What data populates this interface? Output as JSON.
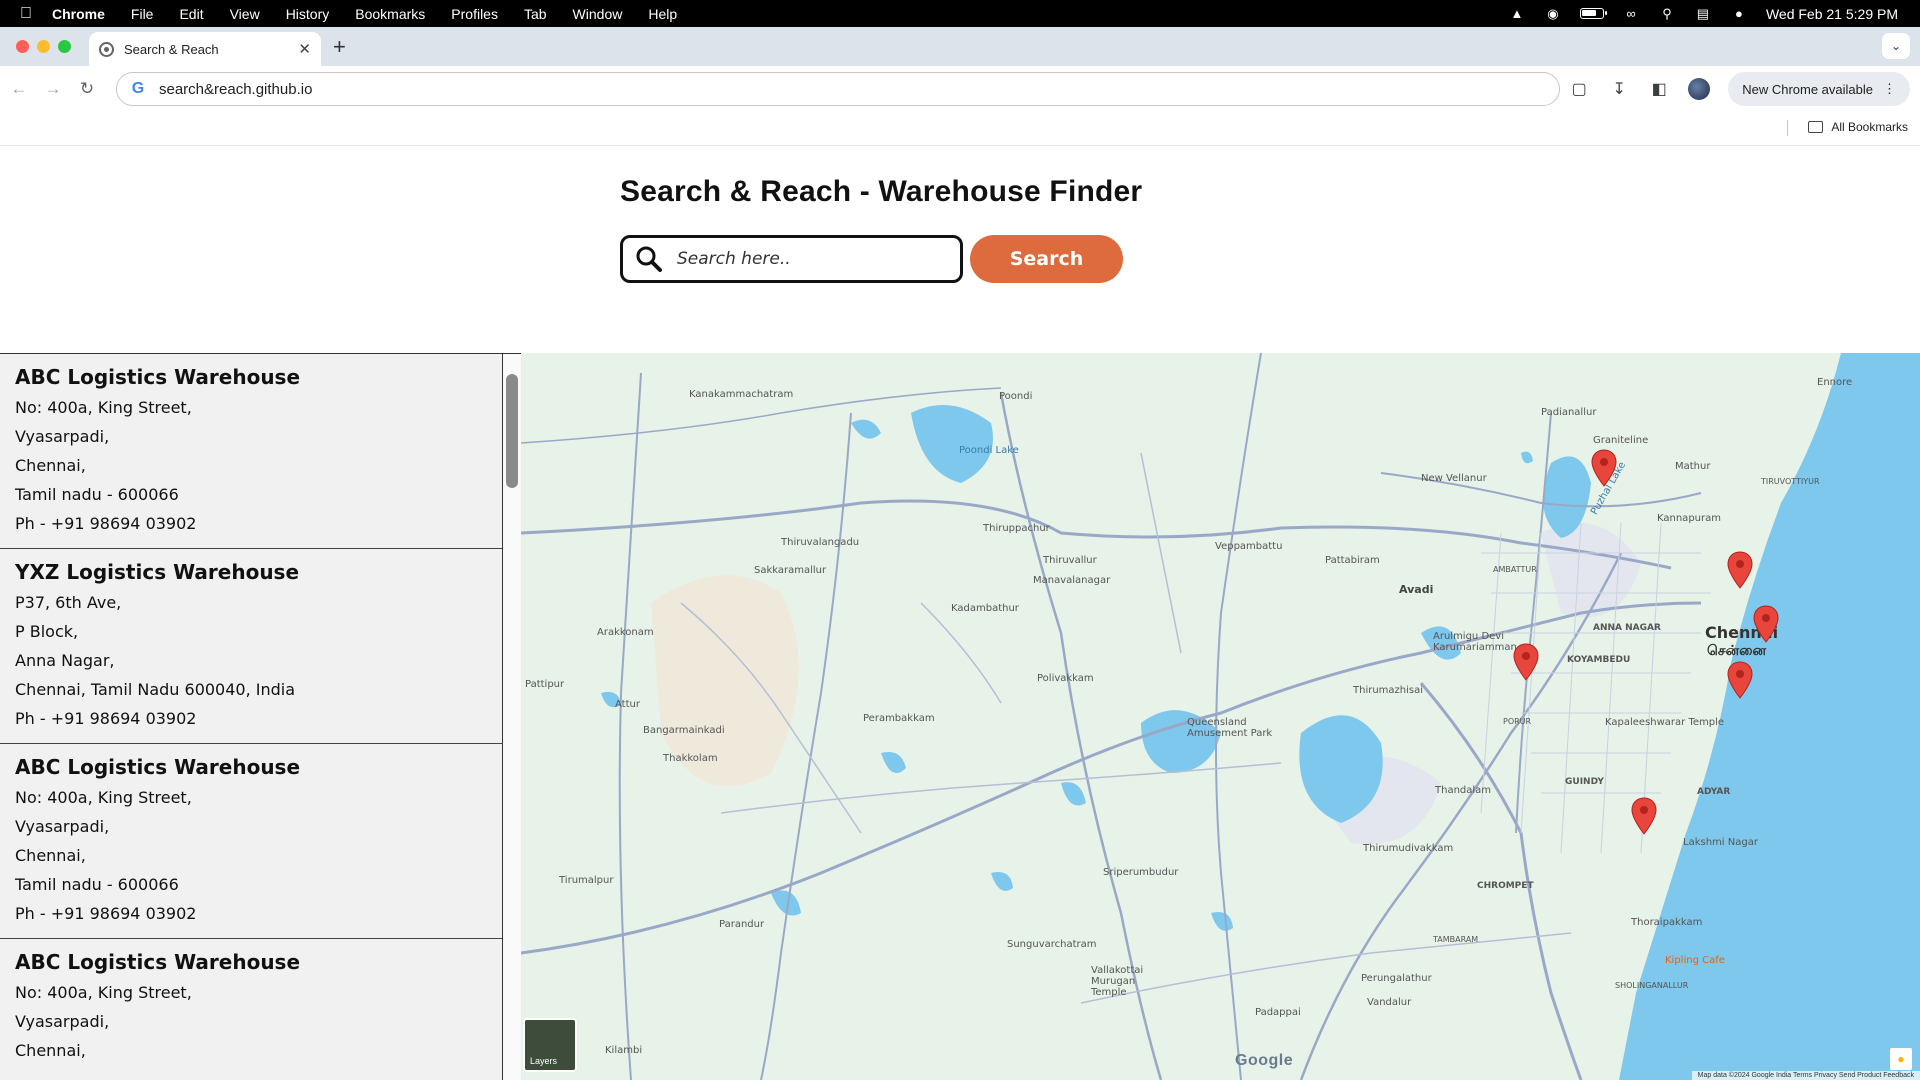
{
  "menubar": {
    "app_name": "Chrome",
    "items": [
      "File",
      "Edit",
      "View",
      "History",
      "Bookmarks",
      "Profiles",
      "Tab",
      "Window",
      "Help"
    ],
    "datetime": "Wed Feb 21  5:29 PM"
  },
  "browser": {
    "tab_title": "Search & Reach",
    "url": "search&reach.github.io",
    "new_chrome_label": "New Chrome available",
    "all_bookmarks_label": "All Bookmarks"
  },
  "page": {
    "title": "Search & Reach - Warehouse Finder",
    "search_placeholder": "Search here..",
    "search_button": "Search"
  },
  "warehouses": [
    {
      "name": "ABC Logistics Warehouse",
      "address_lines": [
        "No: 400a, King Street,",
        "Vyasarpadi,",
        "Chennai,",
        "Tamil nadu - 600066"
      ],
      "phone": "Ph - +91 98694 03902"
    },
    {
      "name": "YXZ Logistics Warehouse",
      "address_lines": [
        "P37, 6th Ave,",
        "P Block,",
        "Anna Nagar,",
        "Chennai, Tamil Nadu 600040, India"
      ],
      "phone": "Ph - +91 98694 03902"
    },
    {
      "name": "ABC Logistics Warehouse",
      "address_lines": [
        "No: 400a, King Street,",
        "Vyasarpadi,",
        "Chennai,",
        "Tamil nadu - 600066"
      ],
      "phone": "Ph - +91 98694 03902"
    },
    {
      "name": "ABC Logistics Warehouse",
      "address_lines": [
        "No: 400a, King Street,",
        "Vyasarpadi,",
        "Chennai,"
      ],
      "phone": ""
    }
  ],
  "map": {
    "labels": {
      "kanakammachatram": "Kanakammachatram",
      "poondi": "Poondi",
      "poondi_lake": "Poondi Lake",
      "thiruvalangadu": "Thiruvalangadu",
      "sakkaramallur": "Sakkaramallur",
      "thiruppachur": "Thiruppachur",
      "thiruvallur": "Thiruvallur",
      "manavalanagar": "Manavalanagar",
      "veppambattu": "Veppambattu",
      "pattabiram": "Pattabiram",
      "avadi": "Avadi",
      "padianallur": "Padianallur",
      "graniteline": "Graniteline",
      "new_vellanur": "New Vellanur",
      "puzhal_lake": "Puzhal Lake",
      "mathur": "Mathur",
      "kannapuram": "Kannapuram",
      "tiruvottiyur": "TIRUVOTTIYUR",
      "ennore": "Ennore",
      "arakkonam": "Arakkonam",
      "kadambathur": "Kadambathur",
      "ambattur": "AMBATTUR",
      "anna_nagar": "ANNA NAGAR",
      "chennai": "Chennai",
      "chennai_tamil": "சென்னை",
      "koyambedu": "KOYAMBEDU",
      "arulmigu": "Arulmigu Devi Karumariamman...",
      "pattipur": "Pattipur",
      "attur": "Attur",
      "bangarmainkadi": "Bangarmainkadi",
      "thakkolam": "Thakkolam",
      "perambakkam": "Perambakkam",
      "polivakkam": "Polivakkam",
      "queensland": "Queensland Amusement Park",
      "thirumazhisai": "Thirumazhisai",
      "porur": "PORUR",
      "kapaleeshwarar": "Kapaleeshwarar Temple",
      "thandalam": "Thandalam",
      "guindy": "GUINDY",
      "adyar": "ADYAR",
      "lakshmi_nagar": "Lakshmi Nagar",
      "thirumudivakkam": "Thirumudivakkam",
      "chrompet": "CHROMPET",
      "sriperumbudur": "Sriperumbudur",
      "thiruvalangadu2": "Tiruvalangadu",
      "parandur": "Parandur",
      "thoraipakkam": "Thoraipakkam",
      "tambaram": "TAMBARAM",
      "sunguvarchatram": "Sunguvarchatram",
      "vallakottai": "Vallakottai Murugan Temple",
      "perungalathur": "Perungalathur",
      "vandalur": "Vandalur",
      "padappai": "Padappai",
      "kipling": "Kipling Cafe",
      "sholinganallur": "SHOLINGANALLUR",
      "kilambi": "Kilambi",
      "thirumalpur": "Tirumalpur"
    },
    "layers_label": "Layers",
    "google_logo": "Google",
    "attribution": "Map data ©2024   Google   India   Terms   Privacy   Send Product Feedback",
    "colors": {
      "land": "#e7f2e8",
      "water": "#7dc8ec",
      "roads": "#9aa8c8",
      "marker": "#e8453c",
      "accent_button": "#dd6b3d"
    }
  }
}
